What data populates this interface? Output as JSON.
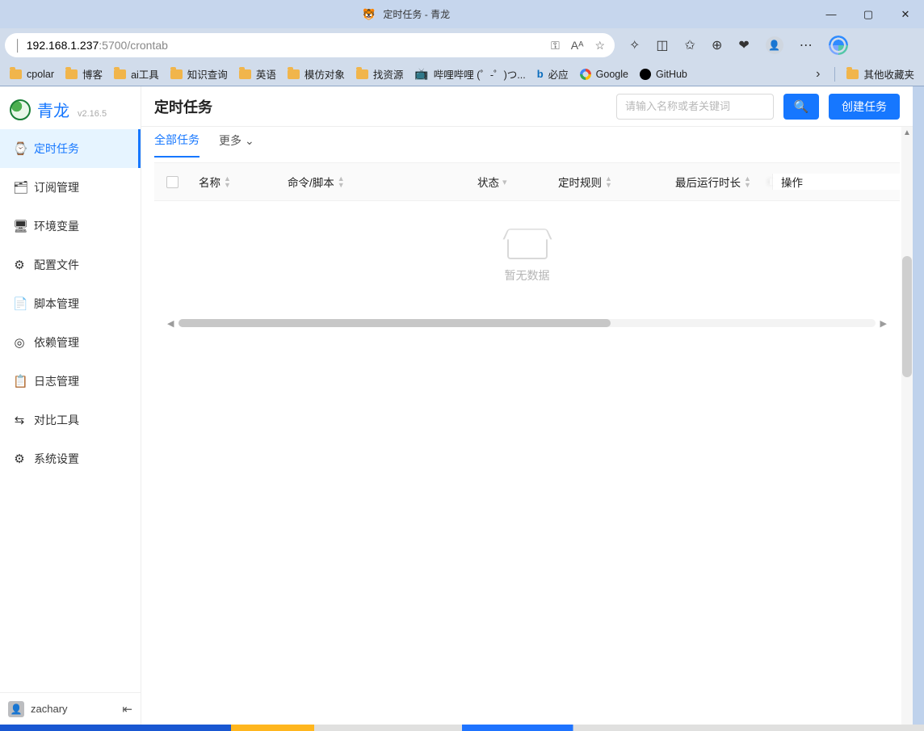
{
  "window": {
    "title": "定时任务 - 青龙"
  },
  "address_bar": {
    "host": "192.168.1.237",
    "port_path": ":5700/crontab"
  },
  "bookmarks": {
    "items": [
      "cpolar",
      "博客",
      "ai工具",
      "知识查询",
      "英语",
      "模仿对象",
      "找资源"
    ],
    "bili": "哔哩哔哩 (゜-゜)つ...",
    "bing": "必应",
    "google": "Google",
    "github": "GitHub",
    "other": "其他收藏夹"
  },
  "brand": {
    "name": "青龙",
    "version": "v2.16.5"
  },
  "sidebar": {
    "items": [
      {
        "icon": "⌚",
        "label": "定时任务",
        "active": true
      },
      {
        "icon": "🗂",
        "label": "订阅管理"
      },
      {
        "icon": "🖥",
        "label": "环境变量"
      },
      {
        "icon": "⚙",
        "label": "配置文件"
      },
      {
        "icon": "📄",
        "label": "脚本管理"
      },
      {
        "icon": "◎",
        "label": "依赖管理"
      },
      {
        "icon": "📋",
        "label": "日志管理"
      },
      {
        "icon": "⇆",
        "label": "对比工具"
      },
      {
        "icon": "⚙",
        "label": "系统设置"
      }
    ]
  },
  "user": {
    "name": "zachary"
  },
  "page": {
    "title": "定时任务",
    "search_placeholder": "请输入名称或者关键词",
    "create_label": "创建任务"
  },
  "tabs": {
    "all": "全部任务",
    "more": "更多"
  },
  "table": {
    "headers": {
      "name": "名称",
      "script": "命令/脚本",
      "status": "状态",
      "cron": "定时规则",
      "last": "最后运行时长",
      "op": "操作"
    },
    "empty": "暂无数据",
    "rows": []
  }
}
